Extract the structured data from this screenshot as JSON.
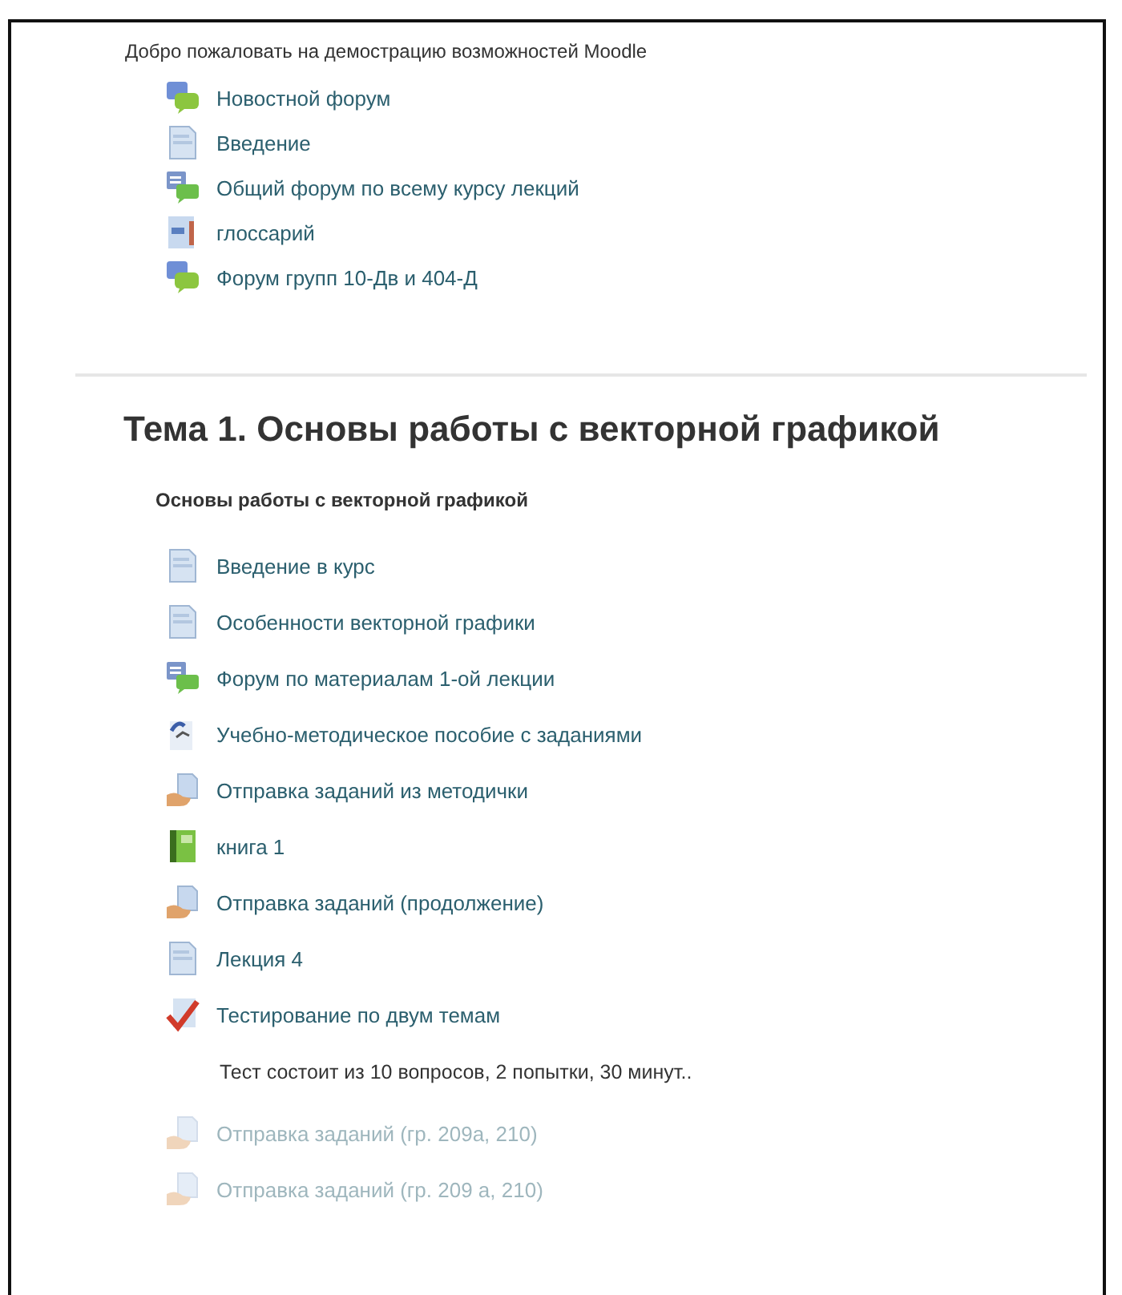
{
  "intro": {
    "summary": "Добро пожаловать на демострацию возможностей Moodle",
    "items": [
      {
        "kind": "forum",
        "label": "Новостной форум",
        "hidden": false
      },
      {
        "kind": "page",
        "label": "Введение",
        "hidden": false
      },
      {
        "kind": "forum-multi",
        "label": "Общий форум по всему курсу лекций",
        "hidden": false
      },
      {
        "kind": "glossary",
        "label": "глоссарий",
        "hidden": false
      },
      {
        "kind": "forum",
        "label": "Форум групп 10-Дв и 404-Д",
        "hidden": false
      }
    ]
  },
  "topic": {
    "title": "Тема 1. Основы работы с векторной графикой",
    "summary": "Основы работы с векторной графикой",
    "items": [
      {
        "kind": "page",
        "label": "Введение в курс",
        "hidden": false
      },
      {
        "kind": "page",
        "label": "Особенности векторной графики",
        "hidden": false
      },
      {
        "kind": "forum-multi",
        "label": "Форум по материалам 1-ой лекции",
        "hidden": false
      },
      {
        "kind": "resource",
        "label": "Учебно-методическое пособие с заданиями",
        "hidden": false
      },
      {
        "kind": "assign",
        "label": "Отправка заданий из методички",
        "hidden": false
      },
      {
        "kind": "book",
        "label": "книга 1",
        "hidden": false
      },
      {
        "kind": "assign",
        "label": "Отправка заданий (продолжение)",
        "hidden": false
      },
      {
        "kind": "page",
        "label": "Лекция 4",
        "hidden": false
      },
      {
        "kind": "quiz",
        "label": "Тестирование по двум темам",
        "hidden": false,
        "description": "Тест состоит из 10 вопросов, 2 попытки, 30 минут.."
      },
      {
        "kind": "assign",
        "label": "Отправка заданий (гр. 209а, 210)",
        "hidden": true
      },
      {
        "kind": "assign",
        "label": "Отправка заданий (гр. 209 а, 210)",
        "hidden": true
      }
    ]
  }
}
